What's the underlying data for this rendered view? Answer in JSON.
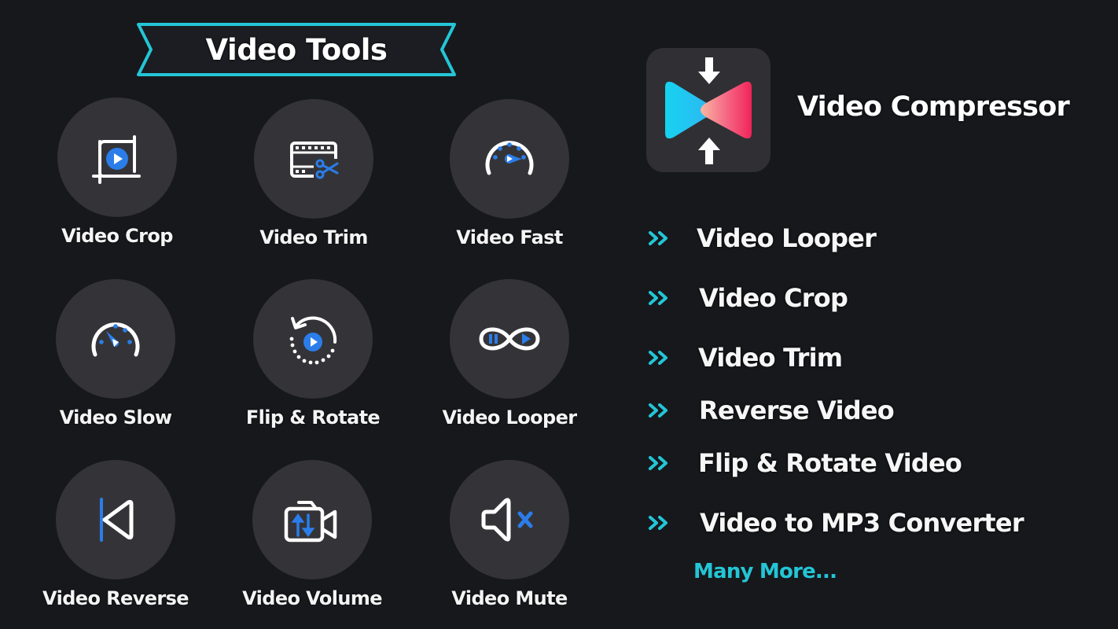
{
  "colors": {
    "background": "#17181c",
    "circle": "#343438",
    "accent_cyan": "#23c6d6",
    "accent_blue": "#2b7de9",
    "logo_gradient_left": "#16d3f0",
    "logo_gradient_right": "#f0245a"
  },
  "banner": {
    "title": "Video Tools"
  },
  "tools": [
    {
      "label": "Video Crop",
      "icon": "crop-play-icon"
    },
    {
      "label": "Video Trim",
      "icon": "film-scissors-icon"
    },
    {
      "label": "Video Fast",
      "icon": "speedometer-fast-icon"
    },
    {
      "label": "Video Slow",
      "icon": "speedometer-slow-icon"
    },
    {
      "label": "Flip & Rotate",
      "icon": "rotate-play-icon"
    },
    {
      "label": "Video Looper",
      "icon": "infinity-loop-icon"
    },
    {
      "label": "Video Reverse",
      "icon": "reverse-icon"
    },
    {
      "label": "Video Volume",
      "icon": "camera-volume-icon"
    },
    {
      "label": "Video Mute",
      "icon": "speaker-mute-icon"
    }
  ],
  "app": {
    "name": "Video Compressor",
    "logo_icon": "compress-logo-icon"
  },
  "features": [
    "Video Looper",
    "Video Crop",
    "Video Trim",
    "Reverse Video",
    "Flip & Rotate Video",
    "Video to MP3 Converter"
  ],
  "more_label": "Many More..."
}
